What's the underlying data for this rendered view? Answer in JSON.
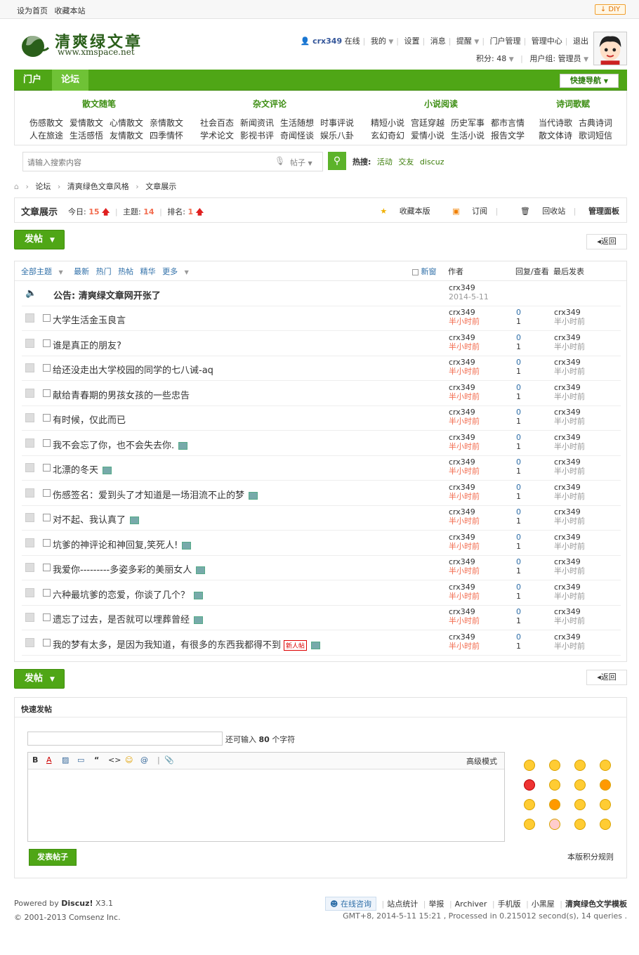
{
  "topbar": {
    "set_home": "设为首页",
    "bookmark": "收藏本站",
    "diy": "DIY"
  },
  "logo": {
    "title": "清爽绿文章",
    "url": "www.xmspace.net"
  },
  "user": {
    "name": "crx349",
    "online": "在线",
    "mine": "我的",
    "settings": "设置",
    "messages": "消息",
    "remind": "提醒",
    "portal_mgmt": "门户管理",
    "admin_center": "管理中心",
    "logout": "退出",
    "points": "积分: 48",
    "group": "用户组: 管理员"
  },
  "nav": {
    "tabs": [
      "门户",
      "论坛"
    ],
    "quick_nav": "快捷导航"
  },
  "subnav": [
    {
      "head": "散文随笔",
      "row1": [
        "伤感散文",
        "爱情散文",
        "心情散文",
        "亲情散文"
      ],
      "row2": [
        "人在旅途",
        "生活感悟",
        "友情散文",
        "四季情怀"
      ]
    },
    {
      "head": "杂文评论",
      "row1": [
        "社会百态",
        "新闻资讯",
        "生活随想",
        "时事评说"
      ],
      "row2": [
        "学术论文",
        "影视书评",
        "奇闻怪谈",
        "娱乐八卦"
      ]
    },
    {
      "head": "小说阅读",
      "row1": [
        "精短小说",
        "宫廷穿越",
        "历史军事",
        "都市言情"
      ],
      "row2": [
        "玄幻奇幻",
        "爱情小说",
        "生活小说",
        "报告文学"
      ]
    },
    {
      "head": "诗词歌赋",
      "row1": [
        "当代诗歌",
        "古典诗词"
      ],
      "row2": [
        "散文体诗",
        "歌词短信"
      ]
    }
  ],
  "search": {
    "placeholder": "请输入搜索内容",
    "type": "帖子",
    "hot_label": "热搜:",
    "hot": [
      "活动",
      "交友",
      "discuz"
    ]
  },
  "breadcrumb": [
    "论坛",
    "清爽绿色文章风格",
    "文章展示"
  ],
  "forum": {
    "title": "文章展示",
    "today_label": "今日:",
    "today": "15",
    "threads_label": "主题:",
    "threads": "14",
    "rank_label": "排名:",
    "rank": "1",
    "actions": [
      "收藏本版",
      "订阅",
      "回收站",
      "管理面板"
    ]
  },
  "buttons": {
    "post": "发帖",
    "back": "返回"
  },
  "list_header": {
    "filters": [
      "全部主题",
      "最新",
      "热门",
      "热帖",
      "精华",
      "更多"
    ],
    "new_window": "新窗",
    "author": "作者",
    "reply_view": "回复/查看",
    "last_post": "最后发表"
  },
  "announcement": {
    "title": "公告: 清爽绿文章网开张了",
    "author": "crx349",
    "date": "2014-5-11"
  },
  "threads": [
    {
      "title": "大学生活金玉良言",
      "author": "crx349",
      "time": "半小时前",
      "replies": "0",
      "views": "1",
      "last_user": "crx349",
      "last_time": "半小时前"
    },
    {
      "title": "谁是真正的朋友?",
      "author": "crx349",
      "time": "半小时前",
      "replies": "0",
      "views": "1",
      "last_user": "crx349",
      "last_time": "半小时前"
    },
    {
      "title": "给还没走出大学校园的同学的七八诫-aq",
      "author": "crx349",
      "time": "半小时前",
      "replies": "0",
      "views": "1",
      "last_user": "crx349",
      "last_time": "半小时前"
    },
    {
      "title": "献给青春期的男孩女孩的一些忠告",
      "author": "crx349",
      "time": "半小时前",
      "replies": "0",
      "views": "1",
      "last_user": "crx349",
      "last_time": "半小时前"
    },
    {
      "title": "有时候，仅此而已",
      "author": "crx349",
      "time": "半小时前",
      "replies": "0",
      "views": "1",
      "last_user": "crx349",
      "last_time": "半小时前"
    },
    {
      "title": "我不会忘了你，也不会失去你.",
      "author": "crx349",
      "time": "半小时前",
      "replies": "0",
      "views": "1",
      "last_user": "crx349",
      "last_time": "半小时前"
    },
    {
      "title": "北漂的冬天",
      "author": "crx349",
      "time": "半小时前",
      "replies": "0",
      "views": "1",
      "last_user": "crx349",
      "last_time": "半小时前"
    },
    {
      "title": "伤感签名：爱到头了才知道是一场泪流不止的梦",
      "author": "crx349",
      "time": "半小时前",
      "replies": "0",
      "views": "1",
      "last_user": "crx349",
      "last_time": "半小时前"
    },
    {
      "title": "对不起、我认真了",
      "author": "crx349",
      "time": "半小时前",
      "replies": "0",
      "views": "1",
      "last_user": "crx349",
      "last_time": "半小时前"
    },
    {
      "title": "坑爹的神评论和神回复,笑死人!",
      "author": "crx349",
      "time": "半小时前",
      "replies": "0",
      "views": "1",
      "last_user": "crx349",
      "last_time": "半小时前"
    },
    {
      "title": "我爱你---------多姿多彩的美丽女人",
      "author": "crx349",
      "time": "半小时前",
      "replies": "0",
      "views": "1",
      "last_user": "crx349",
      "last_time": "半小时前"
    },
    {
      "title": "六种最坑爹的恋爱，你谈了几个？",
      "author": "crx349",
      "time": "半小时前",
      "replies": "0",
      "views": "1",
      "last_user": "crx349",
      "last_time": "半小时前"
    },
    {
      "title": "遗忘了过去，是否就可以埋葬曾经",
      "author": "crx349",
      "time": "半小时前",
      "replies": "0",
      "views": "1",
      "last_user": "crx349",
      "last_time": "半小时前"
    },
    {
      "title": "我的梦有太多，是因为我知道，有很多的东西我都得不到",
      "author": "crx349",
      "time": "半小时前",
      "replies": "0",
      "views": "1",
      "last_user": "crx349",
      "last_time": "半小时前",
      "badge": "新人帖"
    }
  ],
  "quick_post": {
    "title": "快速发帖",
    "hint_pre": "还可输入",
    "hint_num": "80",
    "hint_post": "个字符",
    "advanced": "高级模式",
    "submit": "发表帖子",
    "rules": "本版积分规则"
  },
  "footer": {
    "powered": "Powered by",
    "product": "Discuz!",
    "version": "X3.1",
    "copyright": "© 2001-2013 Comsenz Inc.",
    "links": [
      "在线咨询",
      "站点统计",
      "举报",
      "Archiver",
      "手机版",
      "小黑屋",
      "清爽绿色文学模板"
    ],
    "stats": "GMT+8, 2014-5-11 15:21 , Processed in 0.215012 second(s), 14 queries ."
  },
  "colors": {
    "brand_green": "#4fa616",
    "accent_orange": "#f26c4f",
    "link_blue": "#2f6fa8"
  }
}
